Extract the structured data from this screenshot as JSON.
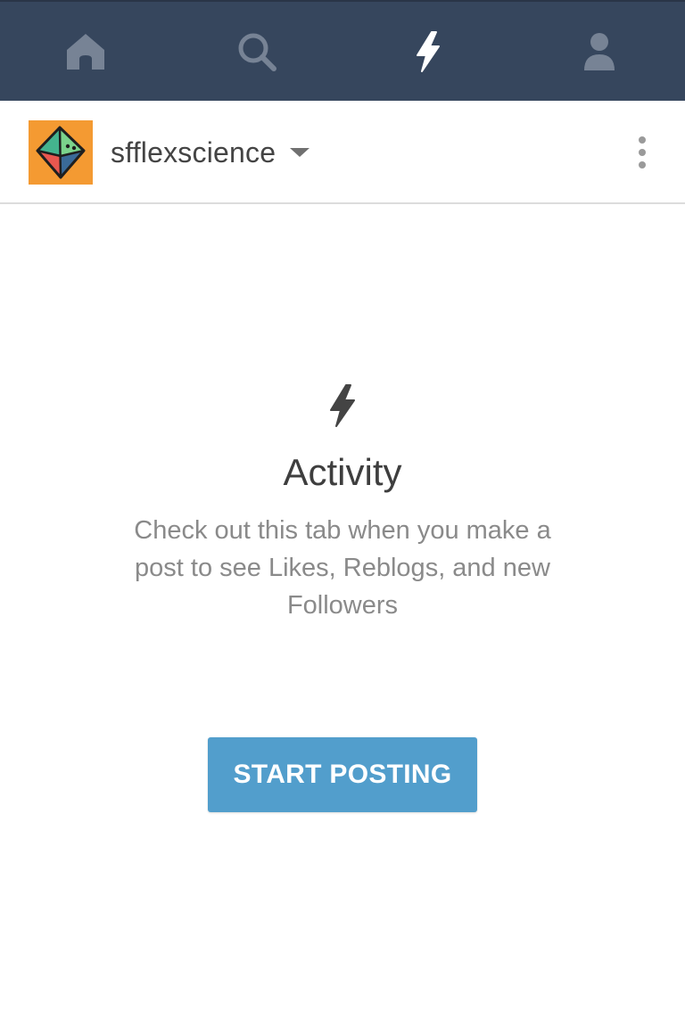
{
  "top_nav": {
    "tabs": [
      {
        "icon": "home-icon",
        "active": false
      },
      {
        "icon": "search-icon",
        "active": false
      },
      {
        "icon": "activity-bolt-icon",
        "active": true
      },
      {
        "icon": "account-icon",
        "active": false
      }
    ],
    "colors": {
      "background": "#36465d",
      "inactive_icon": "#778395",
      "active_icon": "#ffffff"
    }
  },
  "blog_header": {
    "blog_name": "sfflexscience",
    "avatar_icon": "octahedron-avatar-icon",
    "avatar_color": "#f49a32",
    "dropdown_icon": "caret-down-icon",
    "menu_icon": "overflow-menu-icon"
  },
  "empty_state": {
    "icon": "activity-bolt-icon",
    "title": "Activity",
    "description": "Check out this tab when you make a post to see Likes, Reblogs, and new Followers"
  },
  "cta": {
    "label": "START POSTING",
    "color": "#529ecc"
  }
}
